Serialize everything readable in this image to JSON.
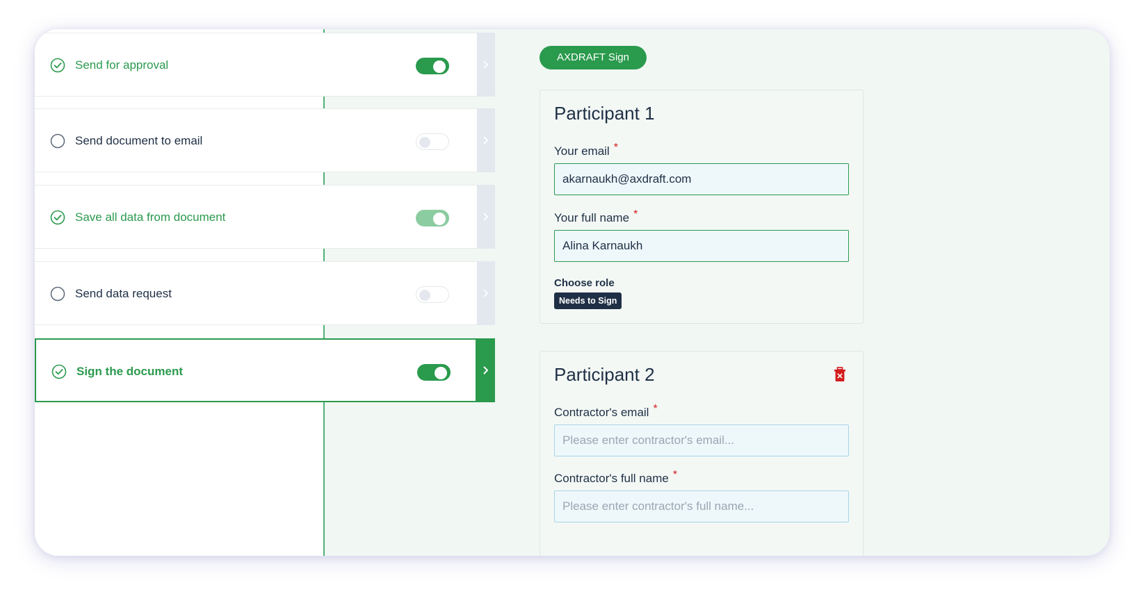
{
  "steps": [
    {
      "label": "Send for approval",
      "checked": true,
      "toggle": "on"
    },
    {
      "label": "Send document to email",
      "checked": false,
      "toggle": "off"
    },
    {
      "label": "Save all data from document",
      "checked": true,
      "toggle": "faded"
    },
    {
      "label": "Send data request",
      "checked": false,
      "toggle": "off"
    },
    {
      "label": "Sign the document",
      "checked": true,
      "toggle": "on",
      "active": true
    }
  ],
  "sign_button": "AXDRAFT Sign",
  "participant1": {
    "title": "Participant 1",
    "email_label": "Your email",
    "email_value": "akarnaukh@axdraft.com",
    "name_label": "Your full name",
    "name_value": "Alina Karnaukh",
    "role_label": "Choose role",
    "role_value": "Needs to Sign"
  },
  "participant2": {
    "title": "Participant 2",
    "email_label": "Contractor's email",
    "email_placeholder": "Please enter contractor's email...",
    "name_label": "Contractor's full name",
    "name_placeholder": "Please enter contractor's full name..."
  },
  "required_mark": "*",
  "colors": {
    "accent": "#2a9a4d",
    "text": "#1f2f45",
    "required": "#d31b1b",
    "badge": "#1f2f45"
  },
  "icons": {
    "check": "check-circle-icon",
    "empty": "empty-circle-icon",
    "arrow": "chevron-right-icon",
    "delete": "trash-icon"
  }
}
